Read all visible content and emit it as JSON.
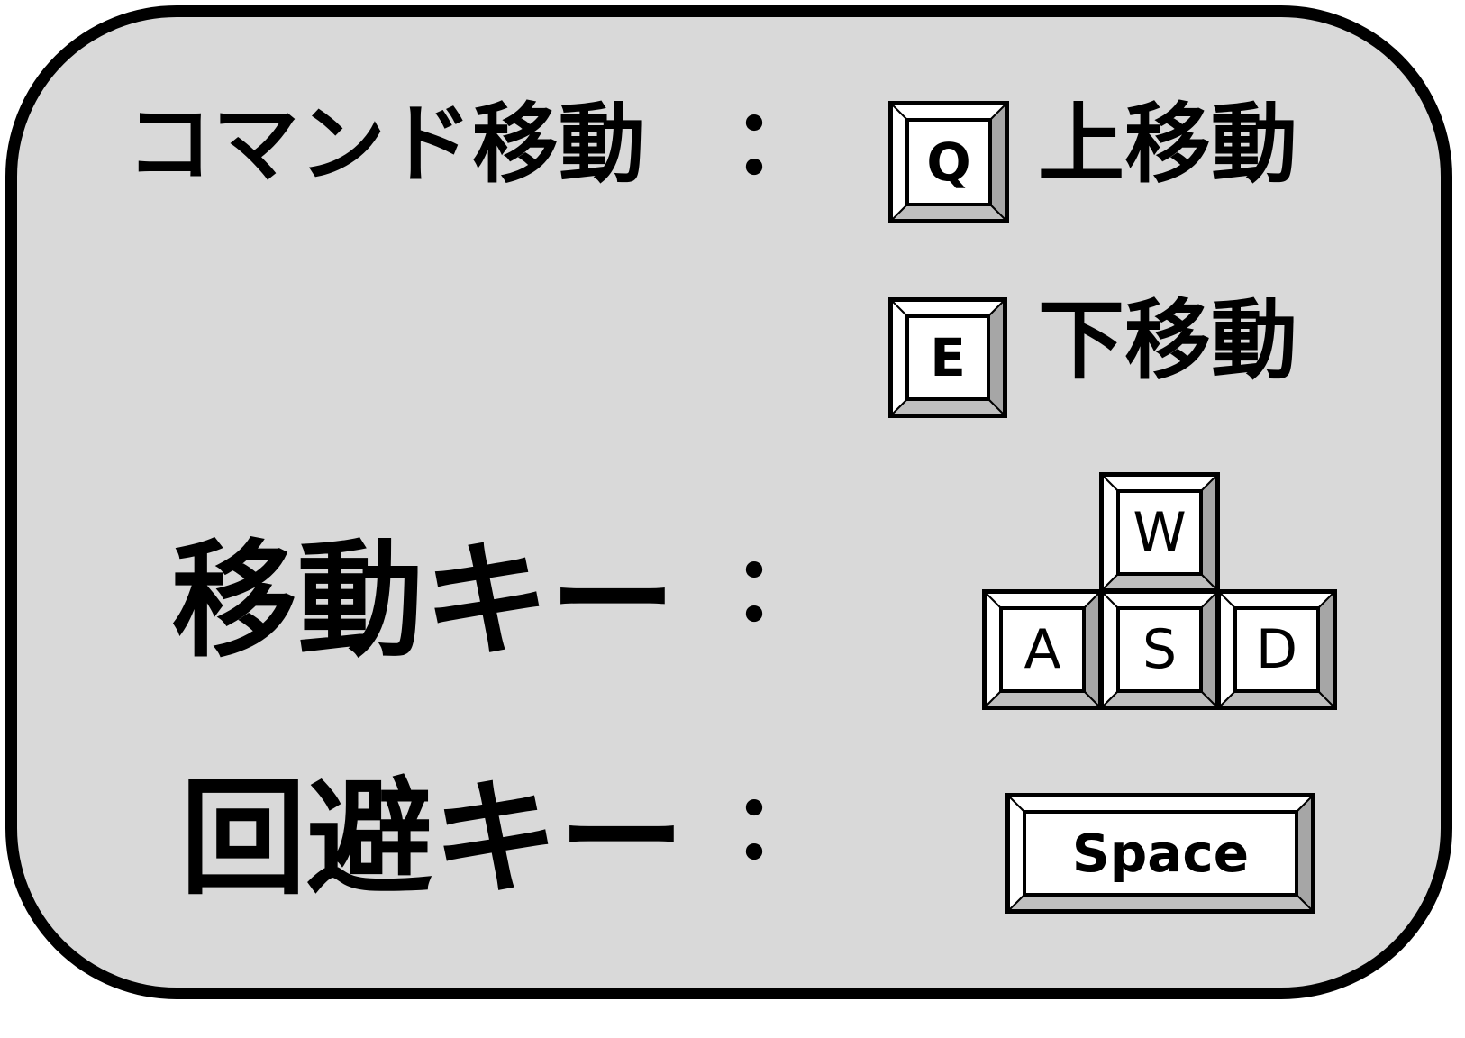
{
  "command_move": {
    "label": "コマンド移動",
    "colon": "：",
    "up": {
      "key": "Q",
      "text": "上移動"
    },
    "down": {
      "key": "E",
      "text": "下移動"
    }
  },
  "move_keys": {
    "label": "移動キー",
    "colon": "：",
    "keys": [
      "W",
      "A",
      "S",
      "D"
    ]
  },
  "dodge_key": {
    "label": "回避キー",
    "colon": "：",
    "key": "Space"
  }
}
